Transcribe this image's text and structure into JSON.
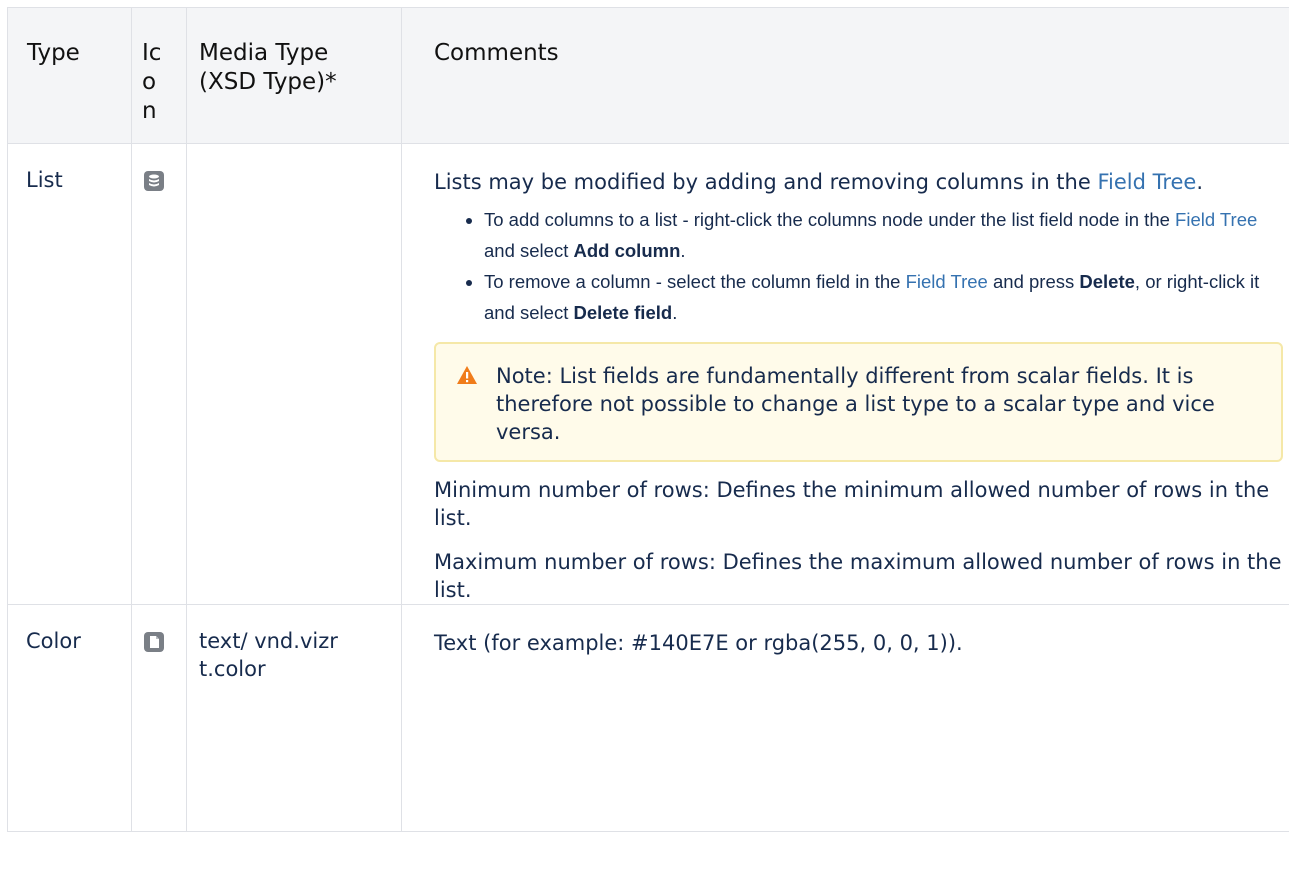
{
  "headers": {
    "type": "Type",
    "icon": "Icon",
    "media_type": "Media Type (XSD Type)*",
    "comments": "Comments"
  },
  "rows": [
    {
      "type": "List",
      "icon": "database-icon",
      "media_type": "",
      "intro_prefix": "Lists may be modified by adding and removing columns in the ",
      "intro_link": "Field Tree",
      "intro_suffix": ".",
      "bullet1_a": "To add columns to a list -  right-click the columns node under the list field node in the ",
      "bullet1_link": "Field Tree",
      "bullet1_b": " and select ",
      "bullet1_bold": "Add column",
      "bullet1_end": ".",
      "bullet2_a": "To remove a column - select the column field in the ",
      "bullet2_link": "Field Tree",
      "bullet2_b": " and press ",
      "bullet2_bold1": "Delete",
      "bullet2_c": ", or right-click it and select ",
      "bullet2_bold2": "Delete field",
      "bullet2_end": ".",
      "note_label": "Note:",
      "note_text": " List fields are fundamentally different from scalar fields. It is therefore not possible to change a list type to a scalar type and vice versa.",
      "min_label": "Minimum number of rows",
      "min_text": ": Defines the minimum allowed number of rows in the list.",
      "max_label": "Maximum number of rows",
      "max_text": ": Defines the maximum allowed number of rows in the list."
    },
    {
      "type": "Color",
      "icon": "document-icon",
      "media_type": "text/ vnd.vizrt.color",
      "comment": "Text (for example: #140E7E or rgba(255, 0, 0, 1))."
    }
  ],
  "colors": {
    "link": "#3572b0",
    "header_bg": "#f4f5f7",
    "note_bg": "#fffbea",
    "note_border": "#f5e8a8",
    "warning": "#f07c1a"
  }
}
